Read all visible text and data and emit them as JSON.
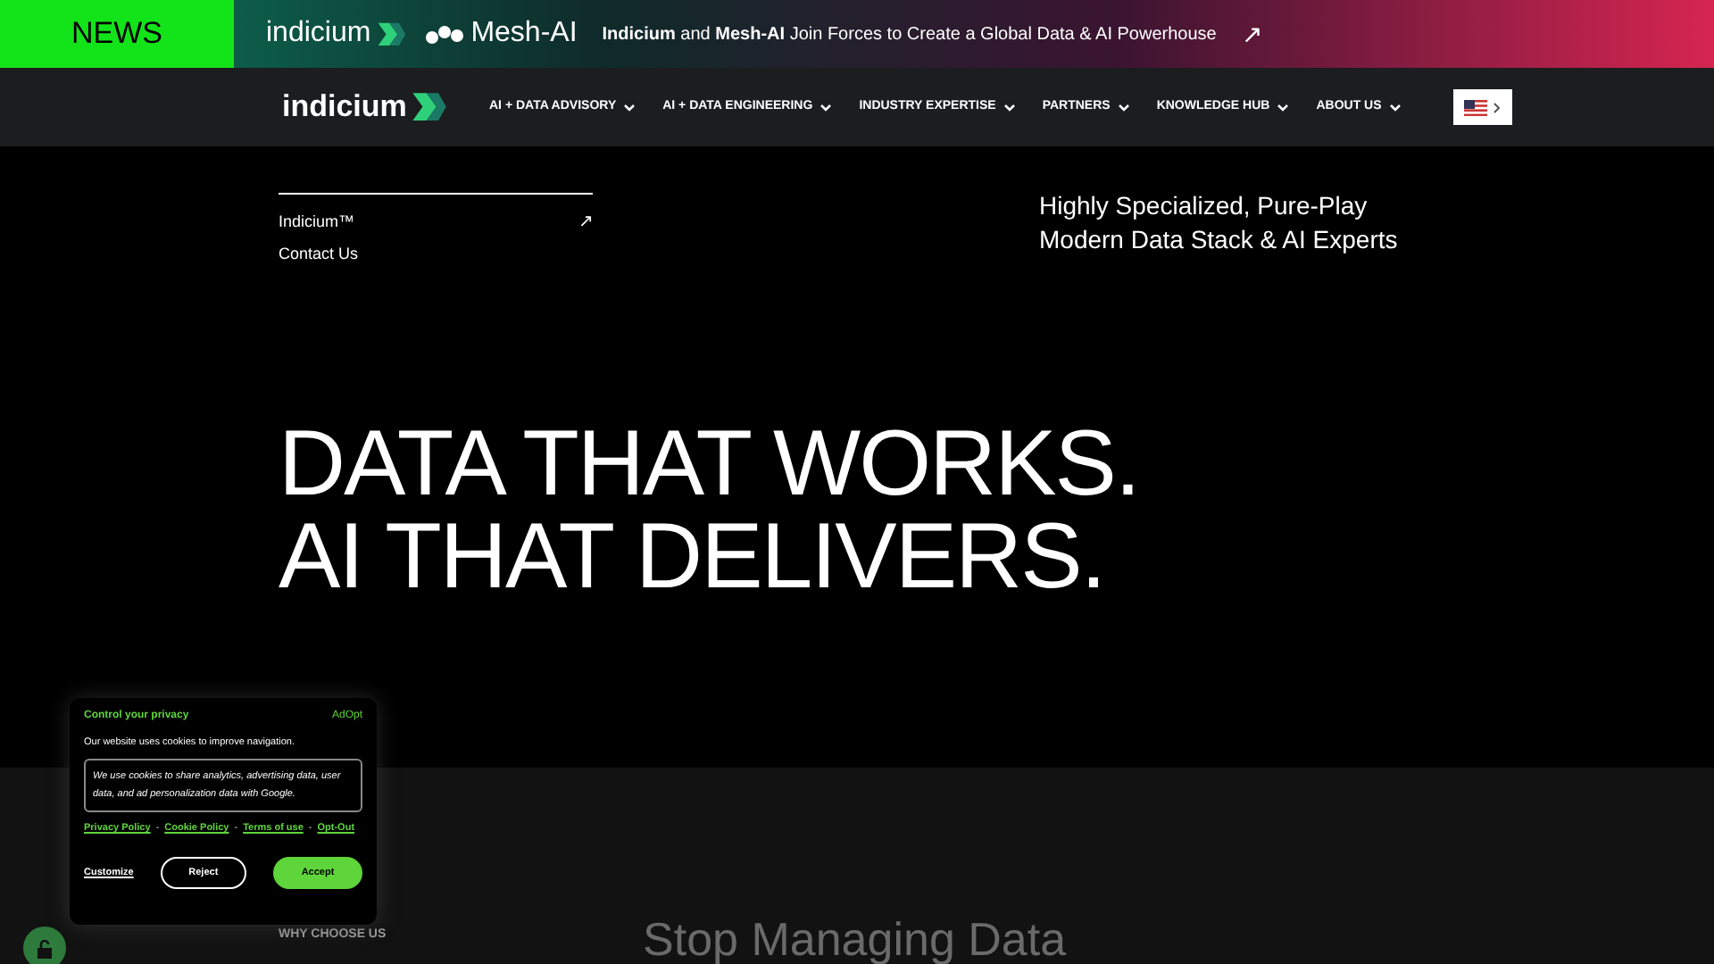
{
  "news_bar": {
    "label": "NEWS",
    "brand_a": "indicium",
    "brand_b": "Mesh-AI",
    "headline": "**Indicium** and **Mesh-AI** Join Forces to Create a Global Data & AI Powerhouse",
    "arrow": "↗"
  },
  "nav": {
    "logo": "indicium",
    "items": [
      {
        "label": "AI + DATA ADVISORY"
      },
      {
        "label": "AI + DATA ENGINEERING"
      },
      {
        "label": "INDUSTRY EXPERTISE"
      },
      {
        "label": "PARTNERS"
      },
      {
        "label": "KNOWLEDGE HUB"
      },
      {
        "label": "ABOUT US"
      }
    ]
  },
  "hero": {
    "links": [
      {
        "label": "Indicium™",
        "arrow": "↗"
      },
      {
        "label": "Contact Us"
      }
    ],
    "tagline": [
      "Highly Specialized, Pure-Play",
      "Modern Data Stack & AI Experts"
    ],
    "headline": [
      "DATA THAT WORKS.",
      "AI THAT DELIVERS."
    ]
  },
  "section": {
    "eyebrow": "WHY CHOOSE US",
    "heading": "Stop Managing Data"
  },
  "cookie_banner": {
    "title": "Control your privacy",
    "vendor": "AdOpt",
    "intro": "Our website uses cookies to improve navigation.",
    "details": "We use cookies to share analytics, advertising data, user data, and ad personalization data with Google.",
    "links": [
      "Privacy Policy",
      "Cookie Policy",
      "Terms of use",
      "Opt-Out"
    ],
    "link_separator": "-",
    "buttons": [
      {
        "label": "Customize",
        "kind": "link"
      },
      {
        "label": "Reject",
        "kind": "outline"
      },
      {
        "label": "Accept",
        "kind": "primary"
      }
    ]
  }
}
